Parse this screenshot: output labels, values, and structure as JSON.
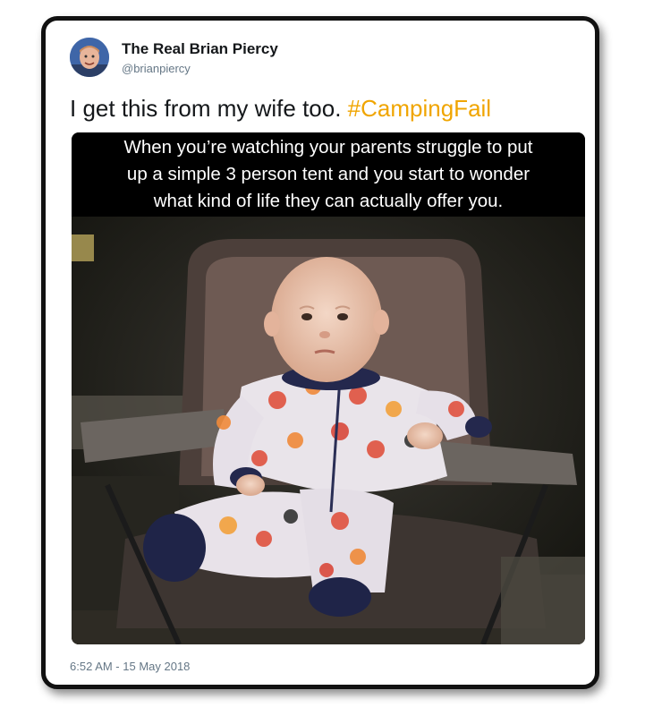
{
  "tweet": {
    "display_name": "The Real Brian Piercy",
    "handle": "@brianpiercy",
    "text": "I get this from my wife too.",
    "hashtag": "#CampingFail",
    "timestamp": "6:52 AM - 15 May 2018"
  },
  "meme": {
    "caption_lines": [
      "When you’re watching your parents struggle to put",
      "up a simple 3 person tent and you start to wonder",
      "what kind of life they can actually offer you."
    ],
    "photo_subject": "baby-in-camping-chair"
  },
  "colors": {
    "hashtag": "#f0a500",
    "name": "#14171a",
    "muted": "#657786",
    "frame": "#111111"
  }
}
